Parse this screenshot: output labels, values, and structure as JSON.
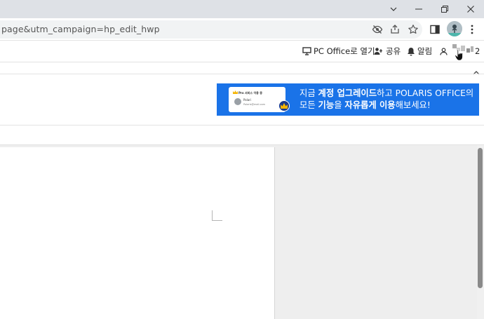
{
  "browser": {
    "url_visible": "page&utm_campaign=hp_edit_hwp",
    "window_controls": [
      "minimize-icon",
      "restore-icon",
      "close-icon"
    ],
    "toolbar_icons": [
      "eye-off-icon",
      "share-icon",
      "star-icon",
      "side-panel-icon",
      "profile-avatar",
      "kebab-menu-icon"
    ]
  },
  "app_toolbar": {
    "open_pc_label": "PC Office로 열기",
    "share_label": "공유",
    "alerts_label": "알림",
    "user_suffix": "2"
  },
  "banner": {
    "line1_pre": "지금 ",
    "line1_bold1": "계정 업그레이드",
    "line1_mid": "하고 POLARIS OFFICE의",
    "line2_pre": "모든 ",
    "line2_bold1": "기능",
    "line2_mid": "을 ",
    "line2_bold2": "자유롭게 이용",
    "line2_post": "해보세요!",
    "card": {
      "title": "Pro 서비스 이용 중",
      "name": "Polari",
      "email": "Polaris@mail.com"
    }
  },
  "colors": {
    "banner_bg": "#1a73e8",
    "titlebar_bg": "#dee1e6",
    "workspace_bg": "#eeeeee"
  }
}
